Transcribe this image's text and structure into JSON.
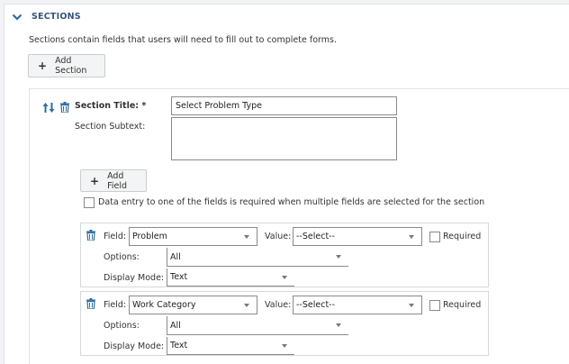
{
  "header": {
    "title": "SECTIONS"
  },
  "description": "Sections contain fields that users will need to fill out to complete forms.",
  "add_section_label": "Add Section",
  "section": {
    "title_label": "Section Title: *",
    "title_value": "Select Problem Type",
    "subtext_label": "Section Subtext:",
    "add_field_label": "Add Field",
    "required_note": "Data entry to one of the fields is required when multiple fields are selected for the section"
  },
  "fields": [
    {
      "field_label": "Field:",
      "field_value": "Problem",
      "value_label": "Value:",
      "value_selected": "--Select--",
      "required_label": "Required",
      "options_label": "Options:",
      "options_value": "All",
      "display_mode_label": "Display Mode:",
      "display_mode_value": "Text"
    },
    {
      "field_label": "Field:",
      "field_value": "Work Category",
      "value_label": "Value:",
      "value_selected": "--Select--",
      "required_label": "Required",
      "options_label": "Options:",
      "options_value": "All",
      "display_mode_label": "Display Mode:",
      "display_mode_value": "Text"
    }
  ],
  "colors": {
    "accent": "#2d6da3",
    "header_text": "#34567a",
    "button_bg": "#f3f4f5"
  },
  "icons": [
    "chevron-down-icon",
    "plus-icon",
    "sort-arrows-icon",
    "trash-icon"
  ]
}
